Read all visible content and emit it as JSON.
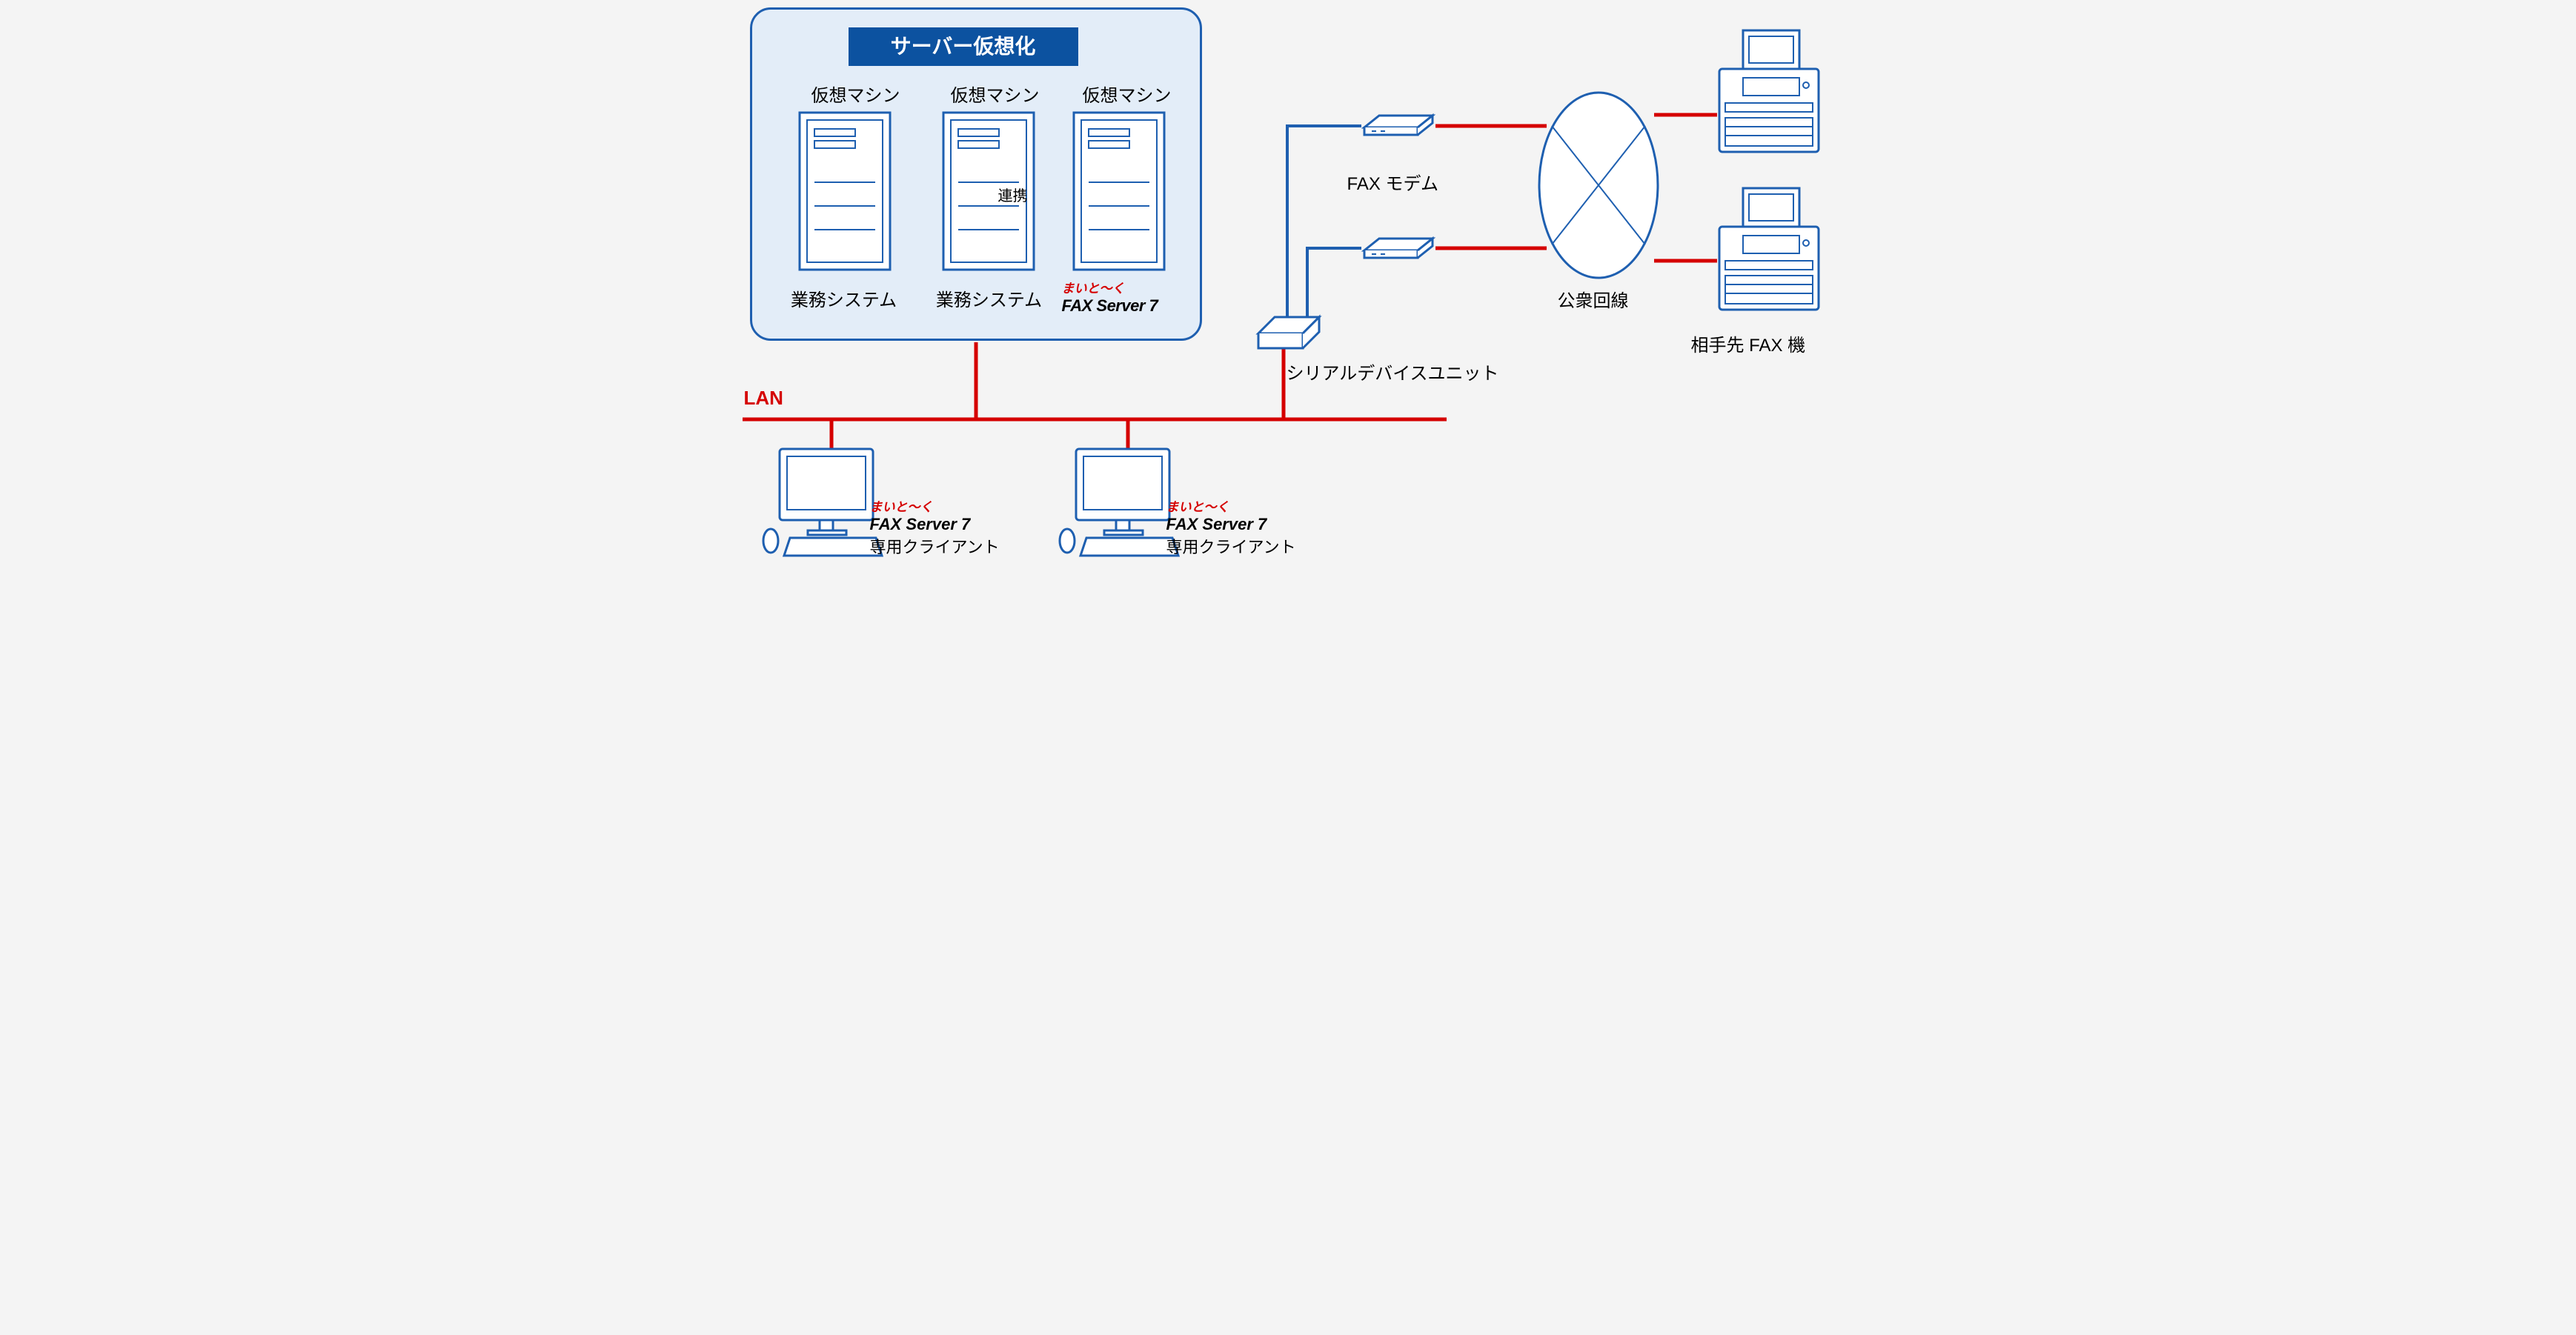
{
  "virt": {
    "title": "サーバー仮想化",
    "vm_label": "仮想マシン",
    "vm_caption1": "業務システム",
    "vm_caption2": "業務システム",
    "link_label": "連携",
    "product_tag": "まいと～く",
    "product_name": "FAX Server 7"
  },
  "lan": "LAN",
  "devices": {
    "fax_modem": "FAX モデム",
    "serial_unit": "シリアルデバイスユニット",
    "public_line": "公衆回線",
    "remote_fax": "相手先 FAX 機"
  },
  "client": {
    "product_tag": "まいと～く",
    "product_name": "FAX Server 7",
    "subtitle": "専用クライアント"
  }
}
